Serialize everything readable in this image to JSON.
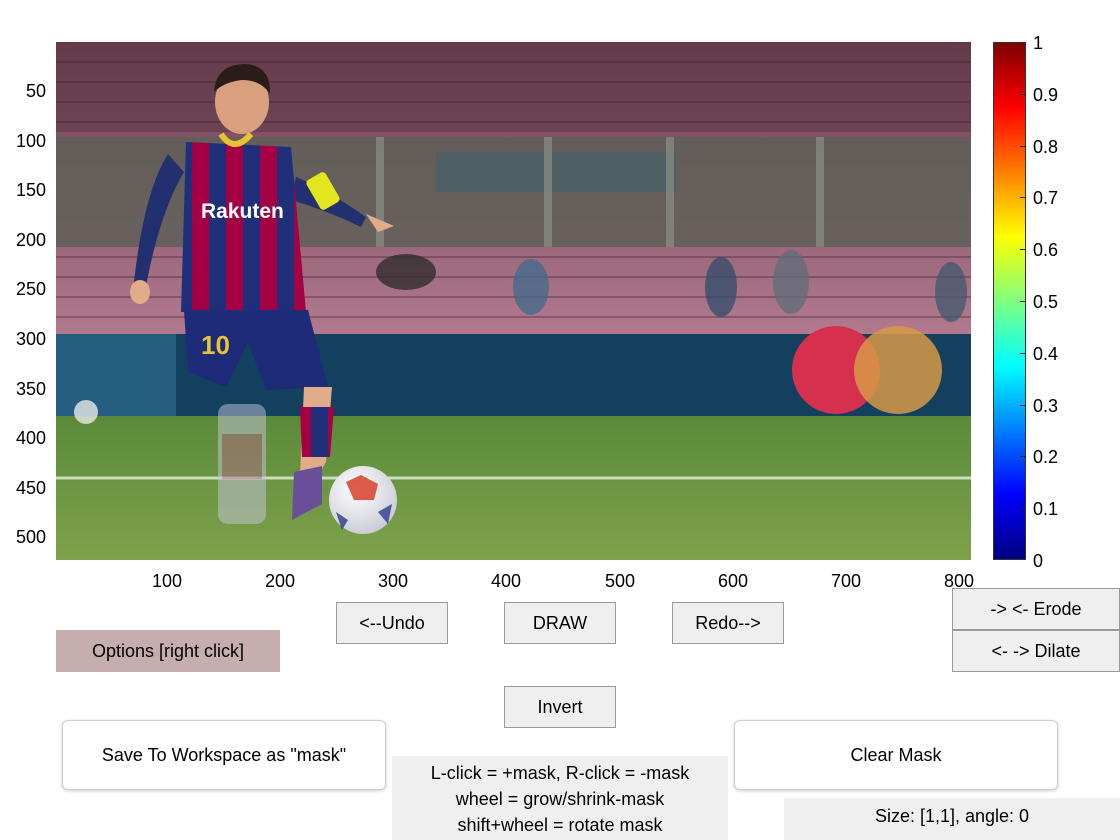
{
  "axes": {
    "y_ticks": [
      "50",
      "100",
      "150",
      "200",
      "250",
      "300",
      "350",
      "400",
      "450",
      "500"
    ],
    "x_ticks": [
      "100",
      "200",
      "300",
      "400",
      "500",
      "600",
      "700",
      "800"
    ]
  },
  "colorbar": {
    "colormap": "jet",
    "ticks": [
      "1",
      "0.9",
      "0.8",
      "0.7",
      "0.6",
      "0.5",
      "0.4",
      "0.3",
      "0.2",
      "0.1",
      "0"
    ]
  },
  "image": {
    "jersey_sponsor": "Rakuten",
    "jersey_number": "10"
  },
  "buttons": {
    "undo": "<--Undo",
    "draw": "DRAW",
    "redo": "Redo-->",
    "erode": "-> <- Erode",
    "dilate": "<- -> Dilate",
    "options": "Options [right click]",
    "invert": "Invert",
    "save": "Save To Workspace as \"mask\"",
    "clear": "Clear Mask"
  },
  "instructions": {
    "line1": "L-click = +mask, R-click = -mask",
    "line2": "wheel = grow/shrink-mask",
    "line3": "shift+wheel = rotate mask"
  },
  "status": {
    "size_angle": "Size: [1,1], angle: 0"
  },
  "colors": {
    "options_bg": "#c7aeae",
    "button_bg": "#efefef",
    "panel_bg": "#efefef"
  }
}
